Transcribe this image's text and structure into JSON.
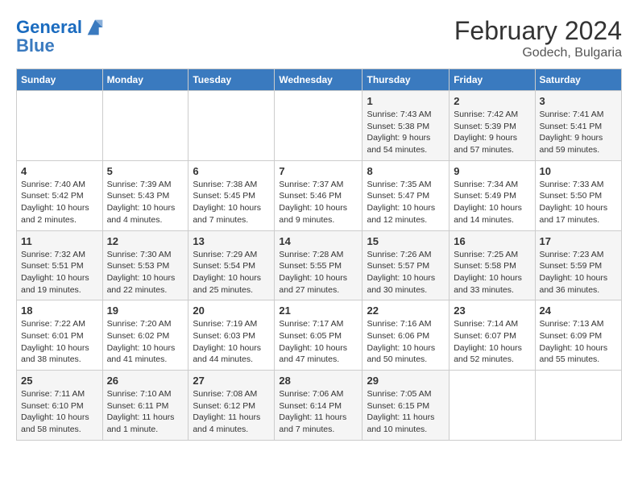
{
  "header": {
    "logo_line1": "General",
    "logo_line2": "Blue",
    "month_title": "February 2024",
    "location": "Godech, Bulgaria"
  },
  "weekdays": [
    "Sunday",
    "Monday",
    "Tuesday",
    "Wednesday",
    "Thursday",
    "Friday",
    "Saturday"
  ],
  "weeks": [
    [
      {
        "day": "",
        "info": ""
      },
      {
        "day": "",
        "info": ""
      },
      {
        "day": "",
        "info": ""
      },
      {
        "day": "",
        "info": ""
      },
      {
        "day": "1",
        "info": "Sunrise: 7:43 AM\nSunset: 5:38 PM\nDaylight: 9 hours\nand 54 minutes."
      },
      {
        "day": "2",
        "info": "Sunrise: 7:42 AM\nSunset: 5:39 PM\nDaylight: 9 hours\nand 57 minutes."
      },
      {
        "day": "3",
        "info": "Sunrise: 7:41 AM\nSunset: 5:41 PM\nDaylight: 9 hours\nand 59 minutes."
      }
    ],
    [
      {
        "day": "4",
        "info": "Sunrise: 7:40 AM\nSunset: 5:42 PM\nDaylight: 10 hours\nand 2 minutes."
      },
      {
        "day": "5",
        "info": "Sunrise: 7:39 AM\nSunset: 5:43 PM\nDaylight: 10 hours\nand 4 minutes."
      },
      {
        "day": "6",
        "info": "Sunrise: 7:38 AM\nSunset: 5:45 PM\nDaylight: 10 hours\nand 7 minutes."
      },
      {
        "day": "7",
        "info": "Sunrise: 7:37 AM\nSunset: 5:46 PM\nDaylight: 10 hours\nand 9 minutes."
      },
      {
        "day": "8",
        "info": "Sunrise: 7:35 AM\nSunset: 5:47 PM\nDaylight: 10 hours\nand 12 minutes."
      },
      {
        "day": "9",
        "info": "Sunrise: 7:34 AM\nSunset: 5:49 PM\nDaylight: 10 hours\nand 14 minutes."
      },
      {
        "day": "10",
        "info": "Sunrise: 7:33 AM\nSunset: 5:50 PM\nDaylight: 10 hours\nand 17 minutes."
      }
    ],
    [
      {
        "day": "11",
        "info": "Sunrise: 7:32 AM\nSunset: 5:51 PM\nDaylight: 10 hours\nand 19 minutes."
      },
      {
        "day": "12",
        "info": "Sunrise: 7:30 AM\nSunset: 5:53 PM\nDaylight: 10 hours\nand 22 minutes."
      },
      {
        "day": "13",
        "info": "Sunrise: 7:29 AM\nSunset: 5:54 PM\nDaylight: 10 hours\nand 25 minutes."
      },
      {
        "day": "14",
        "info": "Sunrise: 7:28 AM\nSunset: 5:55 PM\nDaylight: 10 hours\nand 27 minutes."
      },
      {
        "day": "15",
        "info": "Sunrise: 7:26 AM\nSunset: 5:57 PM\nDaylight: 10 hours\nand 30 minutes."
      },
      {
        "day": "16",
        "info": "Sunrise: 7:25 AM\nSunset: 5:58 PM\nDaylight: 10 hours\nand 33 minutes."
      },
      {
        "day": "17",
        "info": "Sunrise: 7:23 AM\nSunset: 5:59 PM\nDaylight: 10 hours\nand 36 minutes."
      }
    ],
    [
      {
        "day": "18",
        "info": "Sunrise: 7:22 AM\nSunset: 6:01 PM\nDaylight: 10 hours\nand 38 minutes."
      },
      {
        "day": "19",
        "info": "Sunrise: 7:20 AM\nSunset: 6:02 PM\nDaylight: 10 hours\nand 41 minutes."
      },
      {
        "day": "20",
        "info": "Sunrise: 7:19 AM\nSunset: 6:03 PM\nDaylight: 10 hours\nand 44 minutes."
      },
      {
        "day": "21",
        "info": "Sunrise: 7:17 AM\nSunset: 6:05 PM\nDaylight: 10 hours\nand 47 minutes."
      },
      {
        "day": "22",
        "info": "Sunrise: 7:16 AM\nSunset: 6:06 PM\nDaylight: 10 hours\nand 50 minutes."
      },
      {
        "day": "23",
        "info": "Sunrise: 7:14 AM\nSunset: 6:07 PM\nDaylight: 10 hours\nand 52 minutes."
      },
      {
        "day": "24",
        "info": "Sunrise: 7:13 AM\nSunset: 6:09 PM\nDaylight: 10 hours\nand 55 minutes."
      }
    ],
    [
      {
        "day": "25",
        "info": "Sunrise: 7:11 AM\nSunset: 6:10 PM\nDaylight: 10 hours\nand 58 minutes."
      },
      {
        "day": "26",
        "info": "Sunrise: 7:10 AM\nSunset: 6:11 PM\nDaylight: 11 hours\nand 1 minute."
      },
      {
        "day": "27",
        "info": "Sunrise: 7:08 AM\nSunset: 6:12 PM\nDaylight: 11 hours\nand 4 minutes."
      },
      {
        "day": "28",
        "info": "Sunrise: 7:06 AM\nSunset: 6:14 PM\nDaylight: 11 hours\nand 7 minutes."
      },
      {
        "day": "29",
        "info": "Sunrise: 7:05 AM\nSunset: 6:15 PM\nDaylight: 11 hours\nand 10 minutes."
      },
      {
        "day": "",
        "info": ""
      },
      {
        "day": "",
        "info": ""
      }
    ]
  ]
}
